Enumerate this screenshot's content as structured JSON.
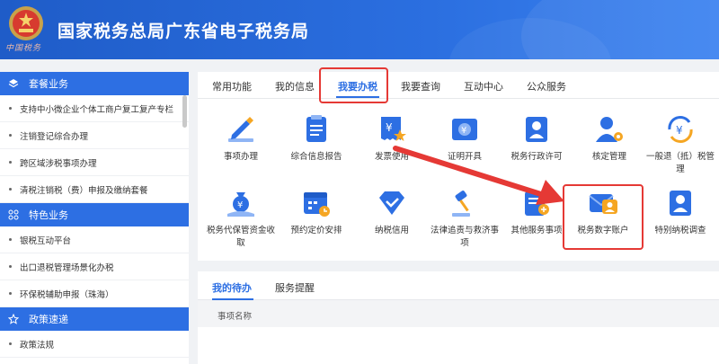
{
  "header": {
    "title": "国家税务总局广东省电子税务局",
    "brand_script": "中国税务",
    "bg_color": "#2b6fe0"
  },
  "sidebar": {
    "sections": [
      {
        "title": "套餐业务",
        "icon": "layers-icon",
        "items": [
          "支持中小微企业个体工商户复工复产专栏",
          "注销登记综合办理",
          "跨区域涉税事项办理",
          "清税注销税（费）申报及缴纳套餐"
        ]
      },
      {
        "title": "特色业务",
        "icon": "grid-icon",
        "items": [
          "银税互动平台",
          "出口退税管理场景化办税",
          "环保税辅助申报（珠海）"
        ]
      },
      {
        "title": "政策速递",
        "icon": "star-icon",
        "items": [
          "政策法规"
        ]
      }
    ]
  },
  "tabs": [
    "常用功能",
    "我的信息",
    "我要办税",
    "我要查询",
    "互动中心",
    "公众服务"
  ],
  "active_tab": "我要办税",
  "tiles": [
    {
      "label": "事项办理",
      "icon": "pen-icon"
    },
    {
      "label": "综合信息报告",
      "icon": "report-icon"
    },
    {
      "label": "发票使用",
      "icon": "invoice-icon"
    },
    {
      "label": "证明开具",
      "icon": "certificate-icon"
    },
    {
      "label": "税务行政许可",
      "icon": "license-icon"
    },
    {
      "label": "核定管理",
      "icon": "user-gear-icon"
    },
    {
      "label": "一般退（抵）税管理",
      "icon": "refund-icon"
    },
    {
      "label": "税务代保管资金收取",
      "icon": "money-bag-icon"
    },
    {
      "label": "预约定价安排",
      "icon": "calendar-icon"
    },
    {
      "label": "纳税信用",
      "icon": "diamond-icon"
    },
    {
      "label": "法律追责与救济事项",
      "icon": "gavel-icon"
    },
    {
      "label": "其他服务事项",
      "icon": "clipboard-icon"
    },
    {
      "label": "税务数字账户",
      "icon": "digital-account-icon"
    },
    {
      "label": "特别纳税调查",
      "icon": "investigation-icon"
    }
  ],
  "bottom": {
    "tabs": [
      "我的待办",
      "服务提醒"
    ],
    "active_tab": "我的待办",
    "column_header": "事项名称"
  },
  "colors": {
    "accent": "#2d6fe3",
    "highlight": "#e53935"
  }
}
